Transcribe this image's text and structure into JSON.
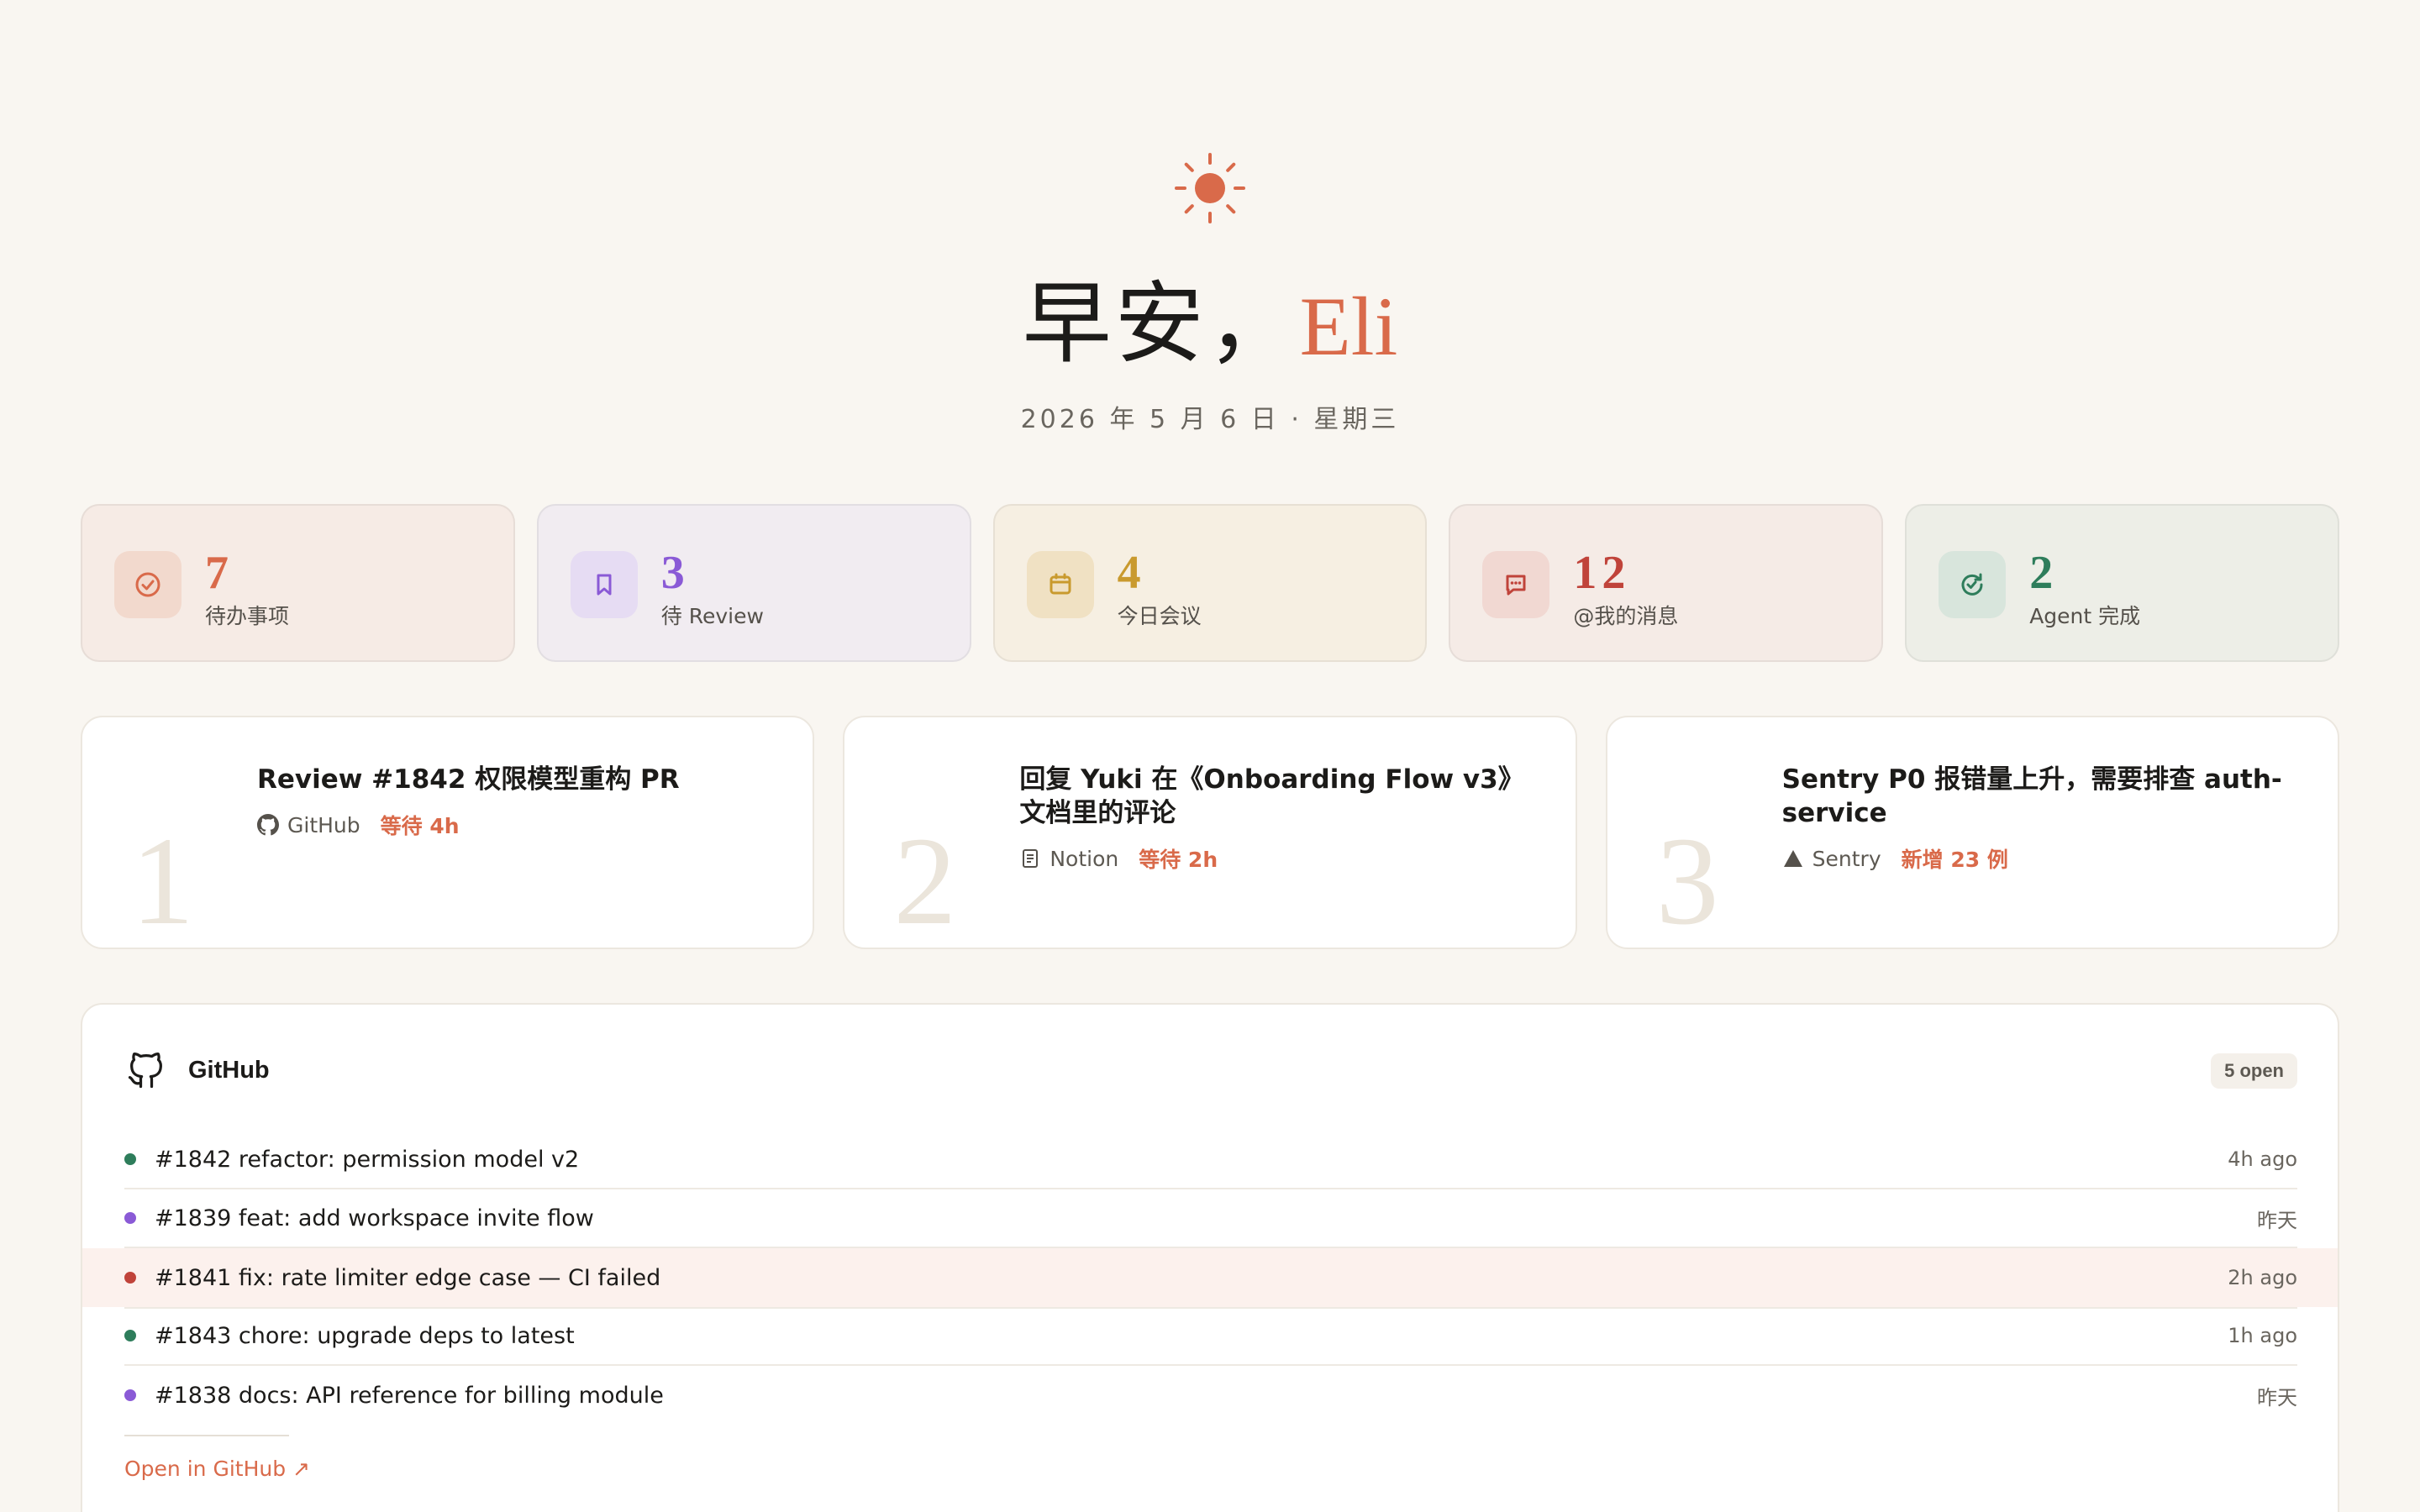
{
  "greeting": {
    "hello": "早安，",
    "name": "Eli",
    "date": "2026 年 5 月 6 日 · 星期三"
  },
  "colors": {
    "accent": "#d96a4a",
    "green": "#2e7d5b",
    "purple": "#8a5ad6",
    "red": "#c0433a",
    "yellow": "#c99a2e"
  },
  "stats": [
    {
      "icon": "check-circle-icon",
      "value": "7",
      "label": "待办事项"
    },
    {
      "icon": "bookmark-icon",
      "value": "3",
      "label": "待 Review"
    },
    {
      "icon": "calendar-icon",
      "value": "4",
      "label": "今日会议"
    },
    {
      "icon": "message-icon",
      "value": "12",
      "label": "@我的消息"
    },
    {
      "icon": "refresh-check-icon",
      "value": "2",
      "label": "Agent 完成"
    }
  ],
  "priorities": [
    {
      "rank": "1",
      "title": "Review #1842 权限模型重构 PR",
      "source_icon": "github-icon",
      "source": "GitHub",
      "tag": "等待 4h"
    },
    {
      "rank": "2",
      "title": "回复 Yuki 在《Onboarding Flow v3》文档里的评论",
      "source_icon": "document-icon",
      "source": "Notion",
      "tag": "等待 2h"
    },
    {
      "rank": "3",
      "title": "Sentry P0 报错量上升，需要排查 auth-service",
      "source_icon": "sentry-triangle-icon",
      "source": "Sentry",
      "tag": "新增 23 例"
    }
  ],
  "github": {
    "title": "GitHub",
    "badge": "5 open",
    "rows": [
      {
        "status": "green",
        "text": "#1842 refactor: permission model v2",
        "time": "4h ago"
      },
      {
        "status": "purple",
        "text": "#1839 feat: add workspace invite flow",
        "time": "昨天"
      },
      {
        "status": "red",
        "text": "#1841 fix: rate limiter edge case — CI failed",
        "time": "2h ago"
      },
      {
        "status": "green",
        "text": "#1843 chore: upgrade deps to latest",
        "time": "1h ago"
      },
      {
        "status": "purple",
        "text": "#1838 docs: API reference for billing module",
        "time": "昨天"
      }
    ],
    "link": "Open in GitHub ↗"
  }
}
